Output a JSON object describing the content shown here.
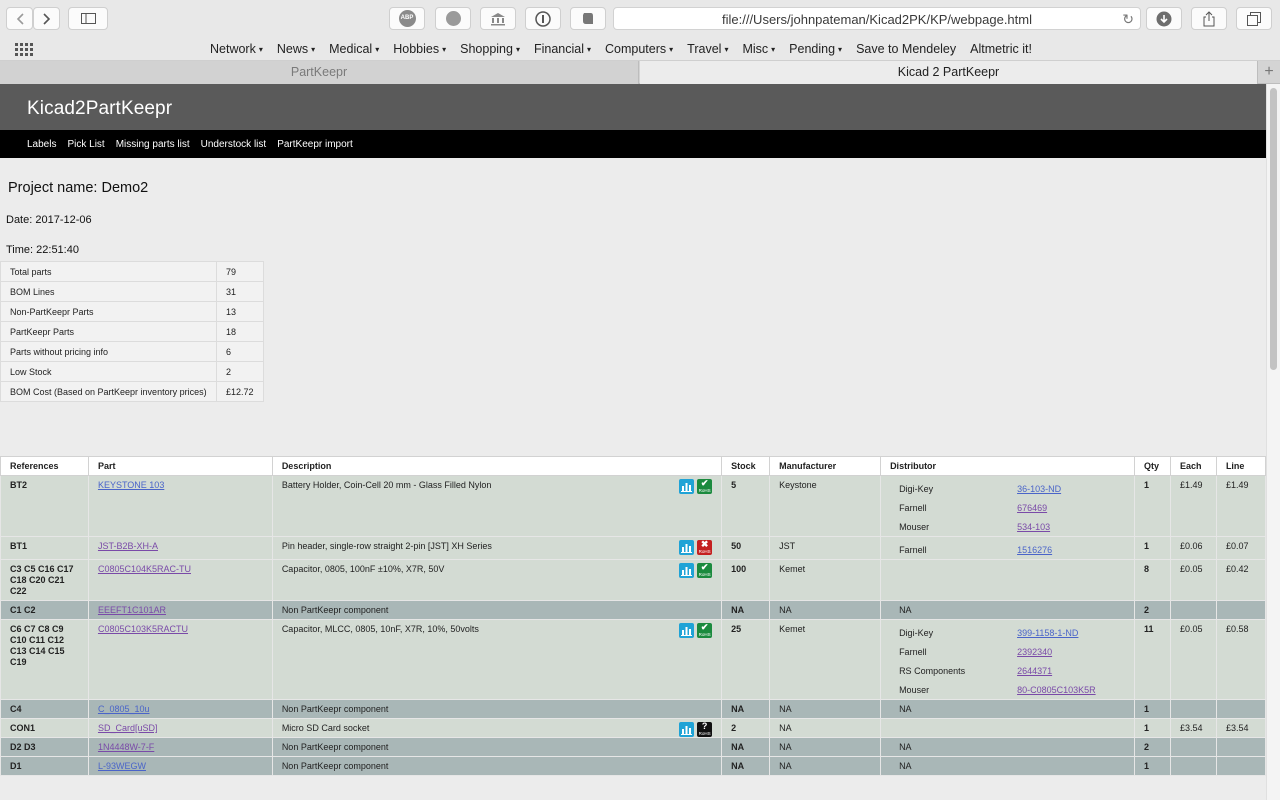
{
  "browser": {
    "url": "file:///Users/johnpateman/Kicad2PK/KP/webpage.html",
    "adblock_label": "ABP",
    "favorites": [
      {
        "label": "Network",
        "menu": true
      },
      {
        "label": "News",
        "menu": true
      },
      {
        "label": "Medical",
        "menu": true
      },
      {
        "label": "Hobbies",
        "menu": true
      },
      {
        "label": "Shopping",
        "menu": true
      },
      {
        "label": "Financial",
        "menu": true
      },
      {
        "label": "Computers",
        "menu": true
      },
      {
        "label": "Travel",
        "menu": true
      },
      {
        "label": "Misc",
        "menu": true
      },
      {
        "label": "Pending",
        "menu": true
      },
      {
        "label": "Save to Mendeley",
        "menu": false
      },
      {
        "label": "Altmetric it!",
        "menu": false
      }
    ],
    "tabs": [
      {
        "label": "PartKeepr",
        "active": false
      },
      {
        "label": "Kicad 2 PartKeepr",
        "active": true
      }
    ]
  },
  "site": {
    "title": "Kicad2PartKeepr",
    "nav": [
      "Labels",
      "Pick List",
      "Missing parts list",
      "Understock list",
      "PartKeepr import"
    ]
  },
  "project": {
    "name_line": "Project name: Demo2",
    "date_line": "Date: 2017-12-06",
    "time_line": "Time: 22:51:40"
  },
  "summary": [
    {
      "label": "Total parts",
      "value": "79"
    },
    {
      "label": "BOM Lines",
      "value": "31"
    },
    {
      "label": "Non-PartKeepr Parts",
      "value": "13"
    },
    {
      "label": "PartKeepr Parts",
      "value": "18"
    },
    {
      "label": "Parts without pricing info",
      "value": "6"
    },
    {
      "label": "Low Stock",
      "value": "2"
    },
    {
      "label": "BOM Cost (Based on PartKeepr inventory prices)",
      "value": "£12.72"
    }
  ],
  "bom": {
    "headers": [
      "References",
      "Part",
      "Description",
      "Stock",
      "Manufacturer",
      "Distributor",
      "Qty",
      "Each",
      "Line"
    ],
    "rows": [
      {
        "refs": [
          "BT2"
        ],
        "part": "KEYSTONE 103",
        "part_visited": false,
        "desc": "Battery Holder, Coin-Cell 20 mm - Glass Filled Nylon",
        "icons": true,
        "rohs": "ok",
        "stock": "5",
        "mfr": "Keystone",
        "dist": [
          {
            "name": "Digi-Key",
            "pn": "36-103-ND"
          },
          {
            "name": "Farnell",
            "pn": "676469"
          },
          {
            "name": "Mouser",
            "pn": "534-103"
          }
        ],
        "qty": "1",
        "each": "£1.49",
        "line": "£1.49",
        "type": "pk"
      },
      {
        "refs": [
          "BT1"
        ],
        "part": "JST-B2B-XH-A",
        "part_visited": true,
        "desc": "Pin header, single-row straight 2-pin [JST] XH Series",
        "icons": true,
        "rohs": "fail",
        "stock": "50",
        "mfr": "JST",
        "dist": [
          {
            "name": "Farnell",
            "pn": "1516276"
          }
        ],
        "qty": "1",
        "each": "£0.06",
        "line": "£0.07",
        "type": "pk"
      },
      {
        "refs": [
          "C3 C5 C16 C17",
          "C18 C20 C21",
          "C22"
        ],
        "part": "C0805C104K5RAC-TU",
        "part_visited": true,
        "desc": "Capacitor, 0805, 100nF ±10%, X7R, 50V",
        "icons": true,
        "rohs": "ok",
        "stock": "100",
        "mfr": "Kemet",
        "dist": [],
        "qty": "8",
        "each": "£0.05",
        "line": "£0.42",
        "type": "pk"
      },
      {
        "refs": [
          "C1 C2"
        ],
        "part": "EEEFT1C101AR",
        "part_visited": true,
        "desc": "Non PartKeepr component",
        "icons": false,
        "rohs": "",
        "stock": "NA",
        "mfr": "NA",
        "dist_na": "NA",
        "dist": [],
        "qty": "2",
        "each": "",
        "line": "",
        "type": "npk"
      },
      {
        "refs": [
          "C6 C7 C8 C9",
          "C10 C11 C12",
          "C13 C14 C15",
          "C19"
        ],
        "part": "C0805C103K5RACTU",
        "part_visited": true,
        "desc": "Capacitor, MLCC, 0805, 10nF, X7R, 10%, 50volts",
        "icons": true,
        "rohs": "ok",
        "stock": "25",
        "mfr": "Kemet",
        "dist": [
          {
            "name": "Digi-Key",
            "pn": "399-1158-1-ND"
          },
          {
            "name": "Farnell",
            "pn": "2392340"
          },
          {
            "name": "RS Components",
            "pn": "2644371"
          },
          {
            "name": "Mouser",
            "pn": "80-C0805C103K5R"
          }
        ],
        "qty": "11",
        "each": "£0.05",
        "line": "£0.58",
        "type": "pk"
      },
      {
        "refs": [
          "C4"
        ],
        "part": "C_0805_10u",
        "part_visited": false,
        "desc": "Non PartKeepr component",
        "icons": false,
        "rohs": "",
        "stock": "NA",
        "mfr": "NA",
        "dist_na": "NA",
        "dist": [],
        "qty": "1",
        "each": "",
        "line": "",
        "type": "npk"
      },
      {
        "refs": [
          "CON1"
        ],
        "part": "SD_Card[uSD]",
        "part_visited": true,
        "desc": "Micro SD Card socket",
        "icons": true,
        "rohs": "unknown",
        "stock": "2",
        "mfr": "NA",
        "dist": [],
        "qty": "1",
        "each": "£3.54",
        "line": "£3.54",
        "type": "pk"
      },
      {
        "refs": [
          "D2 D3"
        ],
        "part": "1N4448W-7-F",
        "part_visited": true,
        "desc": "Non PartKeepr component",
        "icons": false,
        "rohs": "",
        "stock": "NA",
        "mfr": "NA",
        "dist_na": "NA",
        "dist": [],
        "qty": "2",
        "each": "",
        "line": "",
        "type": "npk"
      },
      {
        "refs": [
          "D1"
        ],
        "part": "L-93WEGW",
        "part_visited": false,
        "desc": "Non PartKeepr component",
        "icons": false,
        "rohs": "",
        "stock": "NA",
        "mfr": "NA",
        "dist_na": "NA",
        "dist": [],
        "qty": "1",
        "each": "",
        "line": "",
        "type": "npk"
      }
    ]
  },
  "rohs_icon_text": "RoHS",
  "colors": {
    "header_bg": "#5a5a5a",
    "nav_bg": "#000000",
    "partkeepr_row": "#d3dbd3",
    "non_partkeepr_row": "#a9b7b7",
    "link": "#4a64c9",
    "visited_link": "#7a4aa8",
    "rohs_ok": "#1b8a3e",
    "rohs_fail": "#c42020",
    "datasheet_icon": "#1fa3d6"
  },
  "icons": [
    "back-arrow-icon",
    "forward-arrow-icon",
    "sidebar-icon",
    "adblock-icon",
    "shield-icon",
    "bank-icon",
    "info-icon",
    "evernote-icon",
    "reload-icon",
    "download-icon",
    "share-icon",
    "tabs-icon",
    "grid-icon",
    "datasheet-icon",
    "rohs-icon"
  ]
}
